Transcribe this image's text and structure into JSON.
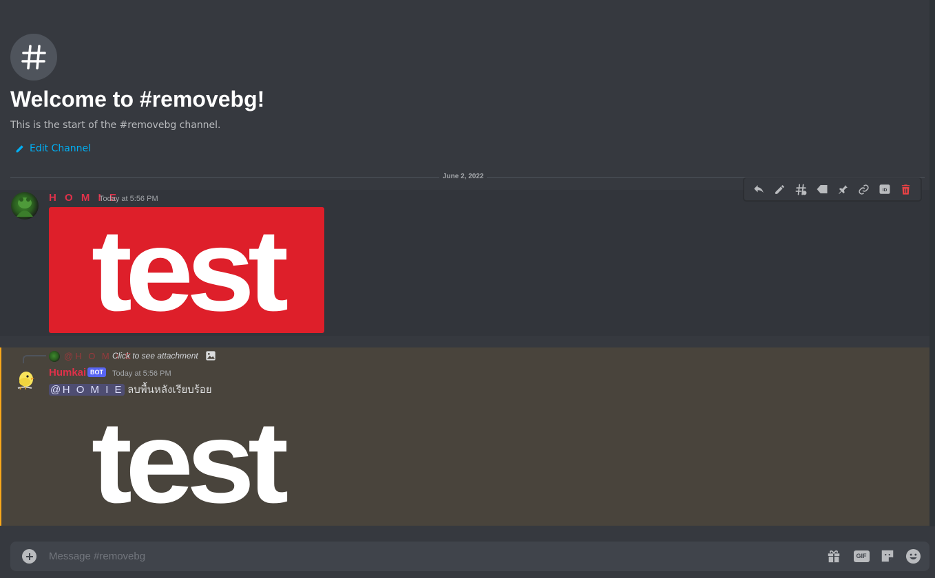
{
  "channel": {
    "hash_symbol": "#",
    "welcome_title": "Welcome to #removebg!",
    "welcome_subtitle": "This is the start of the #removebg channel.",
    "edit_channel_label": "Edit Channel"
  },
  "date_divider": "June 2, 2022",
  "toolbar": {
    "icons": [
      "reply-icon",
      "edit-icon",
      "create-thread-icon",
      "tag-icon",
      "pin-icon",
      "copy-link-icon",
      "copy-id-icon",
      "delete-icon"
    ],
    "delete_color": "#ed4245"
  },
  "messages": [
    {
      "username": "H O M I E",
      "username_color": "#e0314a",
      "timestamp": "Today at 5:56 PM",
      "image_text": "test",
      "image_bg": "#de1f2a"
    },
    {
      "reply": {
        "username": "@H O M I E",
        "text": "Click to see attachment"
      },
      "username": "Humkai",
      "username_color": "#e0314a",
      "bot_badge": "BOT",
      "timestamp": "Today at 5:56 PM",
      "mention": "@H O M I E",
      "content": "ลบพื้นหลังเรียบร้อย",
      "image_text": "test",
      "highlight_color": "#faa81a"
    }
  ],
  "composer": {
    "placeholder": "Message #removebg",
    "gif_label": "GIF"
  }
}
